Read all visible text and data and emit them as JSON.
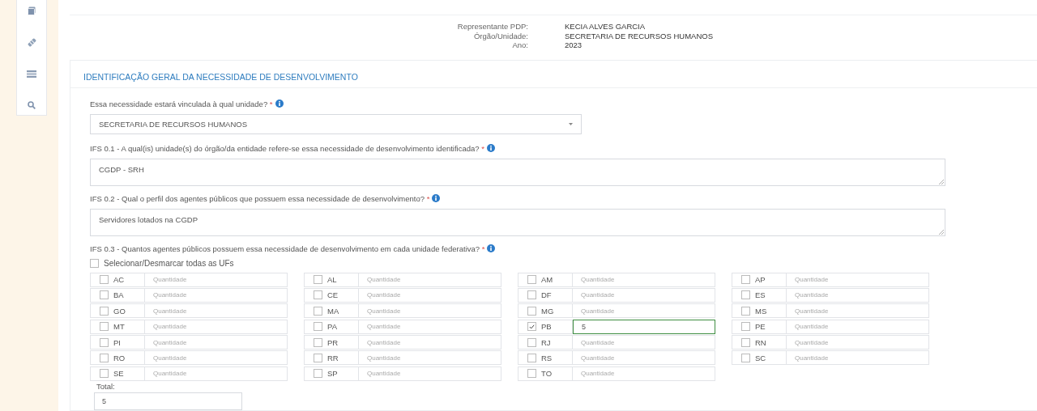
{
  "sidebar": {
    "icons": [
      {
        "kind": "book"
      },
      {
        "kind": "pill"
      },
      {
        "kind": "list"
      },
      {
        "kind": "search"
      }
    ]
  },
  "header": {
    "rows": [
      {
        "label": "Representante PDP:",
        "value": "KECIA ALVES GARCIA"
      },
      {
        "label": "Órgão/Unidade:",
        "value": "SECRETARIA DE RECURSOS HUMANOS"
      },
      {
        "label": "Ano:",
        "value": "2023"
      }
    ]
  },
  "section": {
    "title": "IDENTIFICAÇÃO GERAL DA NECESSIDADE DE DESENVOLVIMENTO",
    "fields": [
      {
        "kind": "select",
        "label": "Essa necessidade estará vinculada à qual unidade?",
        "required_mark": "*",
        "value": "SECRETARIA DE RECURSOS HUMANOS"
      },
      {
        "kind": "textarea",
        "label": "IFS 0.1 - A qual(is) unidade(s) do órgão/da entidade refere-se essa necessidade de desenvolvimento identificada?",
        "required_mark": "*",
        "value": "CGDP - SRH"
      },
      {
        "kind": "textarea",
        "label": "IFS 0.2 - Qual o perfil dos agentes públicos que possuem essa necessidade de desenvolvimento?",
        "required_mark": "*",
        "value": "Servidores lotados na CGDP"
      }
    ],
    "ufs": {
      "label": "IFS 0.3 - Quantos agentes públicos possuem essa necessidade de desenvolvimento em cada unidade federativa?",
      "required_mark": "*",
      "select_all": {
        "label": "Selecionar/Desmarcar todas as UFs",
        "checked": false
      },
      "columns": [
        [
          {
            "uf": "AC",
            "checked": false,
            "placeholder": "Quantidade"
          },
          {
            "uf": "BA",
            "checked": false,
            "placeholder": "Quantidade"
          },
          {
            "uf": "GO",
            "checked": false,
            "placeholder": "Quantidade"
          },
          {
            "uf": "MT",
            "checked": false,
            "placeholder": "Quantidade"
          },
          {
            "uf": "PI",
            "checked": false,
            "placeholder": "Quantidade"
          },
          {
            "uf": "RO",
            "checked": false,
            "placeholder": "Quantidade"
          },
          {
            "uf": "SE",
            "checked": false,
            "placeholder": "Quantidade"
          }
        ],
        [
          {
            "uf": "AL",
            "checked": false,
            "placeholder": "Quantidade"
          },
          {
            "uf": "CE",
            "checked": false,
            "placeholder": "Quantidade"
          },
          {
            "uf": "MA",
            "checked": false,
            "placeholder": "Quantidade"
          },
          {
            "uf": "PA",
            "checked": false,
            "placeholder": "Quantidade"
          },
          {
            "uf": "PR",
            "checked": false,
            "placeholder": "Quantidade"
          },
          {
            "uf": "RR",
            "checked": false,
            "placeholder": "Quantidade"
          },
          {
            "uf": "SP",
            "checked": false,
            "placeholder": "Quantidade"
          }
        ],
        [
          {
            "uf": "AM",
            "checked": false,
            "placeholder": "Quantidade"
          },
          {
            "uf": "DF",
            "checked": false,
            "placeholder": "Quantidade"
          },
          {
            "uf": "MG",
            "checked": false,
            "placeholder": "Quantidade"
          },
          {
            "uf": "PB",
            "checked": true,
            "value": "5"
          },
          {
            "uf": "RJ",
            "checked": false,
            "placeholder": "Quantidade"
          },
          {
            "uf": "RS",
            "checked": false,
            "placeholder": "Quantidade"
          },
          {
            "uf": "TO",
            "checked": false,
            "placeholder": "Quantidade"
          }
        ],
        [
          {
            "uf": "AP",
            "checked": false,
            "placeholder": "Quantidade"
          },
          {
            "uf": "ES",
            "checked": false,
            "placeholder": "Quantidade"
          },
          {
            "uf": "MS",
            "checked": false,
            "placeholder": "Quantidade"
          },
          {
            "uf": "PE",
            "checked": false,
            "placeholder": "Quantidade"
          },
          {
            "uf": "RN",
            "checked": false,
            "placeholder": "Quantidade"
          },
          {
            "uf": "SC",
            "checked": false,
            "placeholder": "Quantidade"
          }
        ]
      ],
      "total": {
        "label": "Total:",
        "value": "5"
      }
    }
  }
}
